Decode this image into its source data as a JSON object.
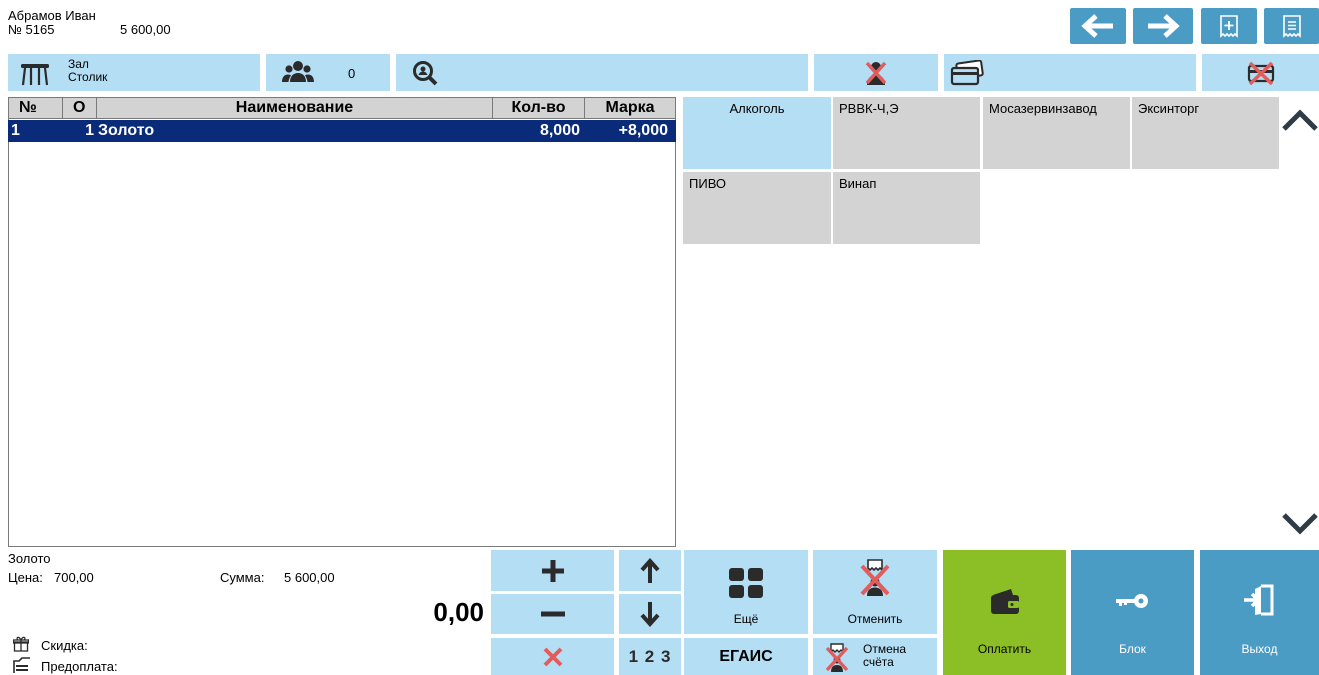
{
  "header": {
    "waiter": "Абрамов Иван",
    "order_no": "№ 5165",
    "order_total": "5 600,00"
  },
  "toolbar": {
    "hall": "Зал",
    "table": "Столик",
    "guests": "0"
  },
  "table": {
    "columns": [
      "№",
      "О",
      "Наименование",
      "Кол-во",
      "Марка"
    ],
    "rows": [
      {
        "no": "1",
        "o": "1",
        "name": "Золото",
        "qty": "8,000",
        "mark": "+8,000"
      }
    ]
  },
  "categories": [
    "Алкоголь",
    "РВВК-Ч,Э",
    "Мосазервинзавод",
    "Эксинторг",
    "ПИВО",
    "Винап"
  ],
  "item_info": {
    "name": "Золото",
    "price_label": "Цена:",
    "price": "700,00",
    "sum_label": "Сумма:",
    "sum": "5 600,00",
    "qty_display": "0,00",
    "discount_label": "Скидка:",
    "prepay_label": "Предоплата:"
  },
  "keys": {
    "digits_label": "1 2 3",
    "more": "Ещё",
    "cancel": "Отменить",
    "egais": "ЕГАИС",
    "cancel_bill": "Отмена счёта",
    "pay": "Оплатить",
    "lock": "Блок",
    "exit": "Выход"
  }
}
